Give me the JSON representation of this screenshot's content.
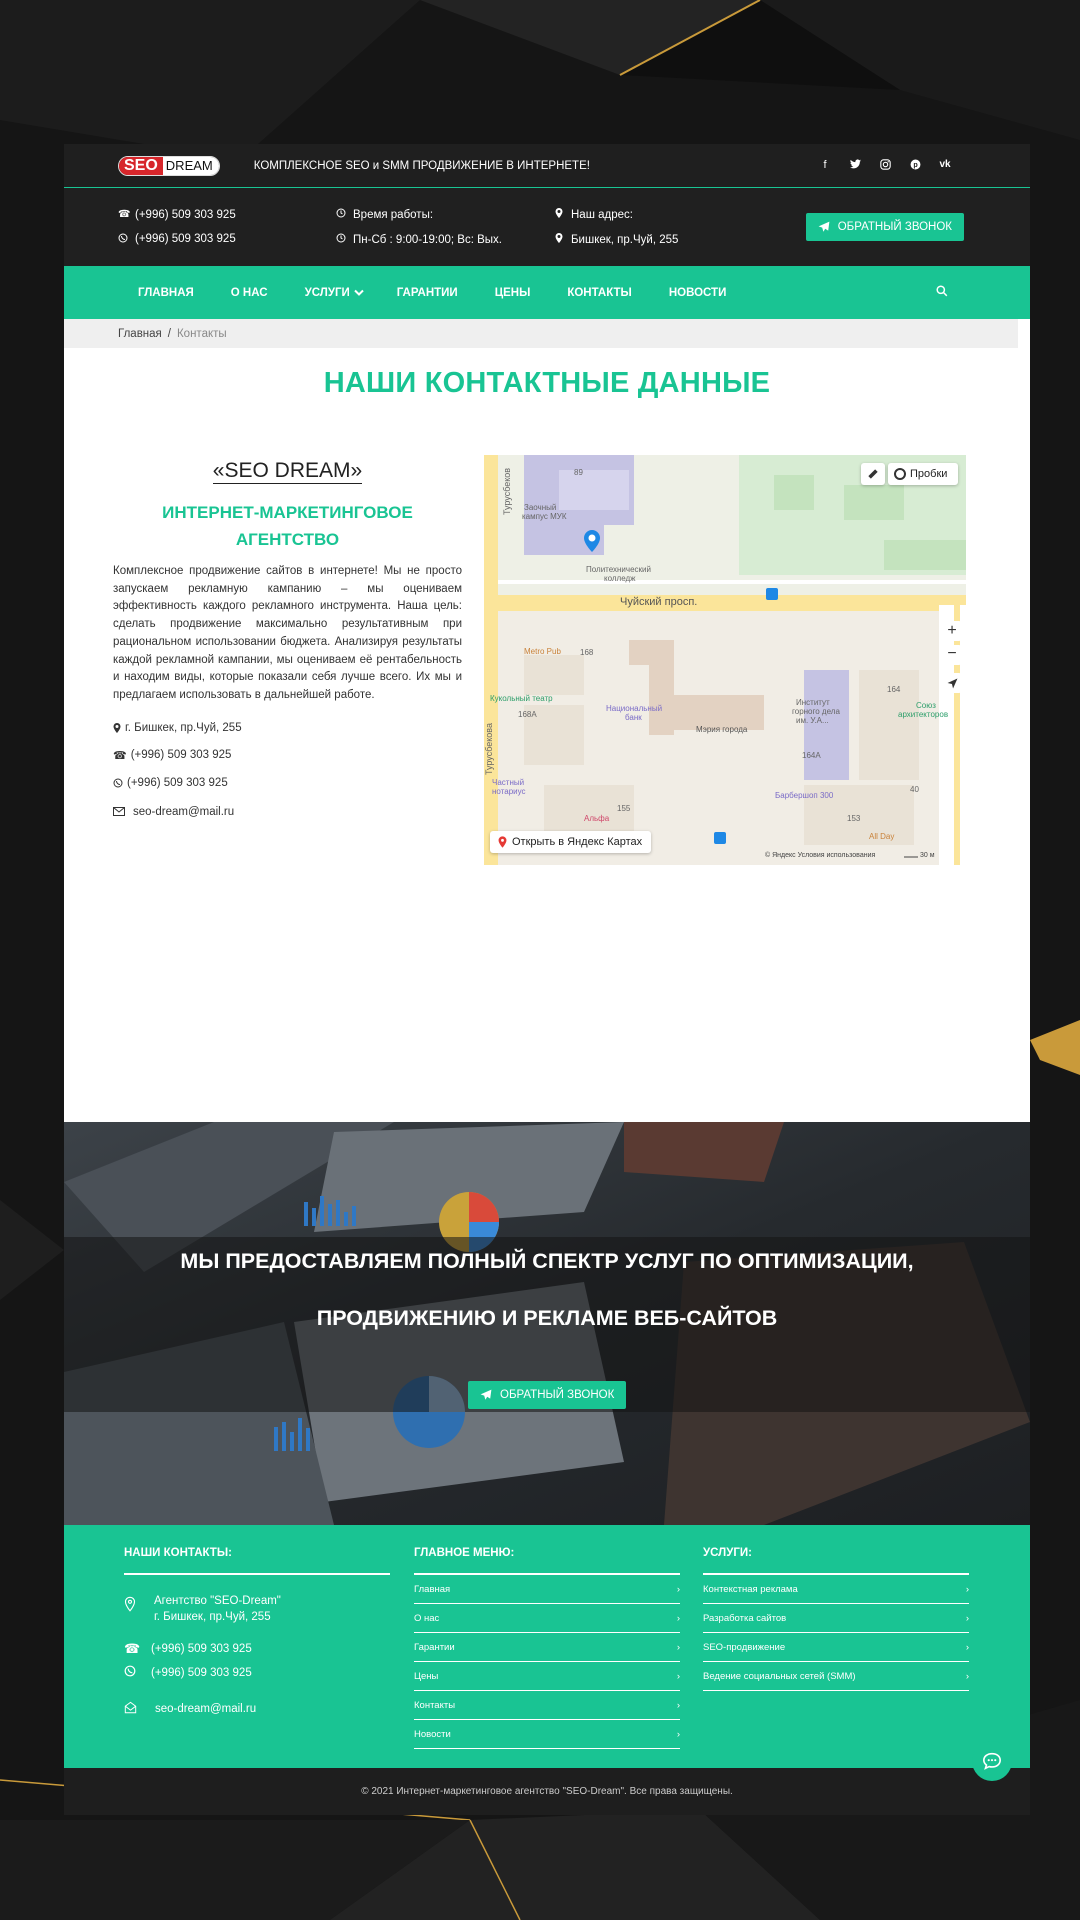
{
  "header": {
    "logo_seo": "SEO",
    "logo_dream": "DREAM",
    "tagline": "КОМПЛЕКСНОЕ SEO и SMM ПРОДВИЖЕНИЕ В ИНТЕРНЕТЕ!",
    "socials": [
      "facebook-icon",
      "twitter-icon",
      "instagram-icon",
      "pinterest-icon",
      "vk-icon"
    ]
  },
  "contact_bar": {
    "phone1": "(+996) 509 303 925",
    "phone2": "(+996) 509 303 925",
    "hours_label": "Время работы:",
    "hours": "Пн-Сб : 9:00-19:00; Вс: Вых.",
    "address_label": "Наш адрес:",
    "address": "Бишкек, пр.Чуй, 255",
    "callback": "ОБРАТНЫЙ ЗВОНОК"
  },
  "nav": {
    "items": [
      "ГЛАВНАЯ",
      "О НАС",
      "УСЛУГИ",
      "ГАРАНТИИ",
      "ЦЕНЫ",
      "КОНТАКТЫ",
      "НОВОСТИ"
    ]
  },
  "breadcrumb": {
    "home": "Главная",
    "current": "Контакты"
  },
  "main": {
    "heading": "НАШИ КОНТАКТНЫЕ ДАННЫЕ",
    "brand": "«SEO DREAM»",
    "agency_line1": "ИНТЕРНЕТ-МАРКЕТИНГОВОЕ",
    "agency_line2": "АГЕНТСТВО",
    "description": "Комплексное продвижение сайтов в интернете! Мы не просто запускаем рекламную кампанию – мы оцениваем эффективность каждого рекламного инструмента. Наша цель: сделать продвижение максимально результативным при рациональном использовании бюджета. Анализируя результаты каждой рекламной кампании, мы оцениваем её рентабельность и находим виды, которые показали себя лучше всего. Их мы и предлагаем использовать в дальнейшей работе.",
    "address": "г. Бишкек, пр.Чуй, 255",
    "phone1": "(+996) 509 303 925",
    "phone2": "(+996) 509 303 925",
    "email": "seo-dream@mail.ru"
  },
  "map": {
    "traffic": "Пробки",
    "open_link": "Открыть в Яндекс Картах",
    "street_main": "Чуйский просп.",
    "street_side1": "Турусбеков",
    "street_side2": "Турусбекова",
    "labels": [
      "Заочный кампус МУК",
      "Политехнический колледж",
      "Metro Pub",
      "Кукольный театр",
      "Национальный банк",
      "Мэрия города",
      "Институт горного дела им. У.А...",
      "Союз архитекторов",
      "Частный нотариус",
      "Альфа",
      "Барбершоп 300",
      "All Day"
    ],
    "numbers": [
      "89",
      "168",
      "168А",
      "164",
      "164А",
      "155",
      "153",
      "40"
    ],
    "copyright": "© Яндекс   Условия использования",
    "scale": "30 м"
  },
  "promo": {
    "line1": "МЫ ПРЕДОСТАВЛЯЕМ ПОЛНЫЙ СПЕКТР УСЛУГ ПО ОПТИМИЗАЦИИ,",
    "line2": "ПРОДВИЖЕНИЮ И РЕКЛАМЕ ВЕБ-САЙТОВ",
    "button": "ОБРАТНЫЙ ЗВОНОК"
  },
  "footer": {
    "contacts_title": "НАШИ КОНТАКТЫ:",
    "agency": "Агентство \"SEO-Dream\"",
    "address": "г. Бишкек, пр.Чуй, 255",
    "phone1": "(+996) 509 303 925",
    "phone2": "(+996) 509 303 925",
    "email": "seo-dream@mail.ru",
    "menu_title": "ГЛАВНОЕ МЕНЮ:",
    "menu": [
      "Главная",
      "О нас",
      "Гарантии",
      "Цены",
      "Контакты",
      "Новости"
    ],
    "services_title": "УСЛУГИ:",
    "services": [
      "Контекстная реклама",
      "Разработка сайтов",
      "SEO-продвижение",
      "Ведение социальных сетей (SMM)"
    ],
    "copyright": "© 2021 Интернет-маркетинговое агентство \"SEO-Dream\". Все права защищены."
  },
  "colors": {
    "accent": "#19c493",
    "dark": "#1f1f1f",
    "logo_red": "#d7262b"
  }
}
